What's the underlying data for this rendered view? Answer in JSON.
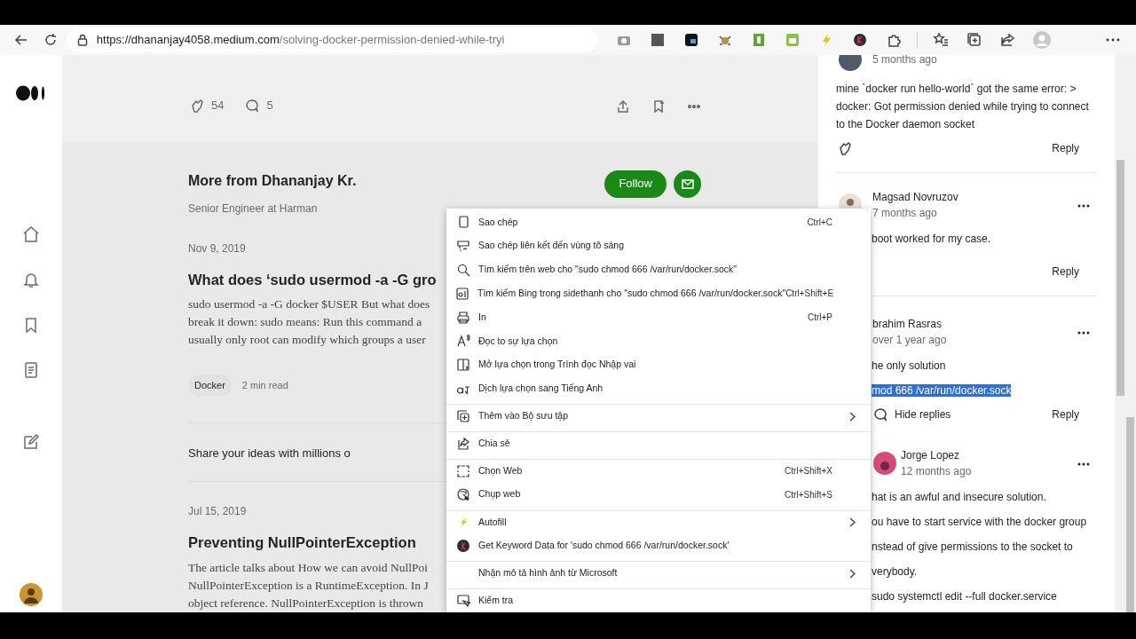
{
  "browser": {
    "url_host": "https://dhananjay4058.medium.com",
    "url_path": "/solving-docker-permission-denied-while-tryi"
  },
  "article_bar": {
    "claps": "54",
    "responses": "5"
  },
  "more_from": {
    "title": "More from Dhananjay Kr.",
    "subtitle": "Senior Engineer at Harman",
    "follow": "Follow"
  },
  "articles": [
    {
      "date": "Nov 9, 2019",
      "title": "What does ‘sudo usermod -a -G gro",
      "excerpt": [
        "sudo usermod -a -G docker $USER But what does",
        "break it down: sudo means: Run this command a",
        "usually only root can modify which groups a user"
      ],
      "tag": "Docker",
      "read_time": "2 min read"
    },
    {
      "date": "Jul 15, 2019",
      "title": "Preventing NullPointerException",
      "excerpt": [
        "The article talks about How we can avoid NullPoi",
        "NullPointerException is a RuntimeException. In J",
        "object reference. NullPointerException is thrown"
      ]
    }
  ],
  "share_banner": "Share your ideas with millions o",
  "comments": [
    {
      "time": "5 months ago",
      "body": [
        {
          "text": "mine `docker run hello-world` got the same error: > docker: Got permission denied while trying to connect to the Docker daemon socket",
          "highlighted": false
        }
      ],
      "show_clap": true,
      "reply": "Reply"
    },
    {
      "author": "Magsad Novruzov",
      "time": "7 months ago",
      "body": [
        {
          "text": "boot worked for my case.",
          "highlighted": false
        }
      ],
      "show_clap": false,
      "reply": "Reply"
    },
    {
      "author": "brahim Rasras",
      "time": "over 1 year ago",
      "body": [
        {
          "text": "he only solution",
          "highlighted": false
        },
        {
          "text": "mod 666 /var/run/docker.sock",
          "highlighted": true
        }
      ],
      "show_clap": false,
      "hide_replies": "Hide replies",
      "reply": "Reply"
    },
    {
      "author": "Jorge Lopez",
      "time": "12 months ago",
      "body": [
        {
          "text": "hat is an awful and insecure solution.",
          "highlighted": false
        },
        {
          "text": "ou have to start service with the docker group",
          "highlighted": false
        },
        {
          "text": "nstead of give permissions to the socket to",
          "highlighted": false
        },
        {
          "text": "verybody.",
          "highlighted": false
        },
        {
          "text": "sudo systemctl edit --full docker.service",
          "highlighted": false
        }
      ],
      "show_clap": false
    }
  ],
  "context_menu": [
    {
      "label": "Sao chép",
      "shortcut": "Ctrl+C",
      "submenu": false,
      "separator_before": false
    },
    {
      "label": "Sao chép liên kết đến vùng tô sáng",
      "submenu": false,
      "separator_before": false
    },
    {
      "label": "Tìm kiếm trên web cho \"sudo chmod 666 /var/run/docker.sock\"",
      "submenu": false,
      "separator_before": false
    },
    {
      "label": "Tìm kiếm Bing trong sidethanh cho \"sudo chmod 666 /var/run/docker.sock\"",
      "shortcut": "Ctrl+Shift+E",
      "submenu": false,
      "separator_before": false
    },
    {
      "label": "In",
      "shortcut": "Ctrl+P",
      "submenu": false,
      "separator_before": false
    },
    {
      "label": "Đọc to sự lựa chọn",
      "submenu": false,
      "separator_before": false
    },
    {
      "label": "Mở lựa chọn trong Trình đọc Nhập vai",
      "submenu": false,
      "separator_before": false
    },
    {
      "label": "Dịch lựa chọn sang Tiếng Anh",
      "submenu": false,
      "separator_before": false
    },
    {
      "label": "Thêm vào Bộ sưu tập",
      "submenu": true,
      "separator_before": true
    },
    {
      "label": "Chia sẻ",
      "submenu": false,
      "separator_before": true
    },
    {
      "label": "Chọn Web",
      "shortcut": "Ctrl+Shift+X",
      "submenu": false,
      "separator_before": true
    },
    {
      "label": "Chụp web",
      "shortcut": "Ctrl+Shift+S",
      "submenu": false,
      "separator_before": false
    },
    {
      "label": "Autofill",
      "submenu": true,
      "separator_before": true
    },
    {
      "label": "Get Keyword Data for 'sudo chmod 666 /var/run/docker.sock'",
      "submenu": false,
      "separator_before": false
    },
    {
      "label": "Nhận mô tả hình ảnh từ Microsoft",
      "submenu": true,
      "separator_before": true
    },
    {
      "label": "Kiểm tra",
      "submenu": false,
      "separator_before": true
    }
  ]
}
